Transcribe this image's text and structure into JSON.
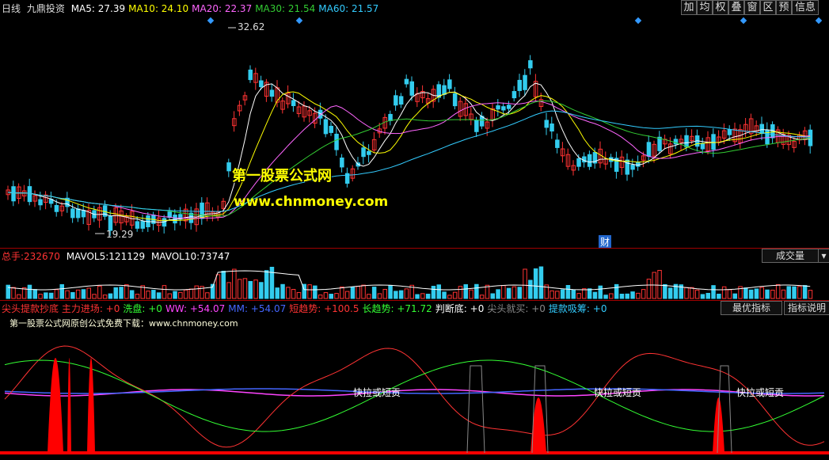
{
  "header": {
    "period": "日线",
    "stock_name": "九鼎投资",
    "ma": [
      {
        "label": "MA5:",
        "value": "27.39",
        "color": "#ffffff"
      },
      {
        "label": "MA10:",
        "value": "24.10",
        "color": "#ffff00"
      },
      {
        "label": "MA20:",
        "value": "22.37",
        "color": "#ff66ff"
      },
      {
        "label": "MA30:",
        "value": "21.54",
        "color": "#33cc33"
      },
      {
        "label": "MA60:",
        "value": "21.57",
        "color": "#33ccff"
      }
    ],
    "buttons": [
      "加",
      "均",
      "权",
      "叠",
      "窗",
      "区",
      "预",
      "信息"
    ]
  },
  "price_panel": {
    "high_label": "32.62",
    "low_label": "19.29",
    "finance_marker": "财",
    "watermark_cn": "第一股票公式网",
    "watermark_url": "www.chnmoney.com"
  },
  "volume_panel": {
    "total": {
      "label": "总手:",
      "value": "232670",
      "color": "#ff3333"
    },
    "mavol5": {
      "label": "MAVOL5:",
      "value": "121129",
      "color": "#ffffff"
    },
    "mavol10": {
      "label": "MAVOL10:",
      "value": "73747",
      "color": "#ffffff"
    },
    "mode_button": "成交量"
  },
  "indicator_panel": {
    "items": [
      {
        "label": "尖头提款抄底 主力进场:",
        "value": "+0",
        "color": "#ff3333"
      },
      {
        "label": "洗盘:",
        "value": "+0",
        "color": "#33ff33"
      },
      {
        "label": "WW:",
        "value": "+54.07",
        "color": "#ff44ff"
      },
      {
        "label": "MM:",
        "value": "+54.07",
        "color": "#4466ff"
      },
      {
        "label": "短趋势:",
        "value": "+100.5",
        "color": "#ff3333"
      },
      {
        "label": "长趋势:",
        "value": "+71.72",
        "color": "#33ff33"
      },
      {
        "label": "判断底:",
        "value": "+0",
        "color": "#ffffff"
      },
      {
        "label": "尖头就买:",
        "value": "+0",
        "color": "#888888"
      },
      {
        "label": "提款吸筹:",
        "value": "+0",
        "color": "#33ccff"
      }
    ],
    "buttons": [
      "最优指标",
      "指标说明"
    ],
    "source_note": "第一股票公式网原创公式免费下载：www.chnmoney.com",
    "annotation": "快拉或短贡"
  }
}
